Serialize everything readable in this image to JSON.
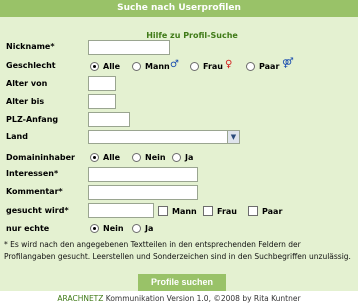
{
  "header": {
    "title": "Suche nach Userprofilen"
  },
  "help_link": "Hilfe zu Profil-Suche",
  "form": {
    "nickname_label": "Nickname*",
    "geschlecht_label": "Geschlecht",
    "geschlecht_options": [
      "Alle",
      "Mann",
      "Frau",
      "Paar"
    ],
    "geschlecht_selected": "Alle",
    "alter_von_label": "Alter von",
    "alter_bis_label": "Alter bis",
    "plz_label": "PLZ-Anfang",
    "land_label": "Land",
    "land_value": "",
    "domaininhaber_label": "Domaininhaber",
    "domaininhaber_options": [
      "Alle",
      "Nein",
      "Ja"
    ],
    "domaininhaber_selected": "Alle",
    "interessen_label": "Interessen*",
    "kommentar_label": "Kommentar*",
    "gesucht_label": "gesucht wird*",
    "gesucht_options": [
      "Mann",
      "Frau",
      "Paar"
    ],
    "nur_echte_label": "nur echte",
    "nur_echte_options": [
      "Nein",
      "Ja"
    ],
    "nur_echte_selected": "Nein"
  },
  "note": "* Es wird nach den angegebenen Textteilen in den entsprechenden Feldern der Profilangaben gesucht. Leerstellen und Sonderzeichen sind in den Suchbegriffen unzulässig.",
  "submit_label": "Profile suchen",
  "footer": {
    "brand": "ARACHNETZ",
    "text": " Kommunikation Version 1.0,   ©2008 by Rita Kuntner"
  },
  "colors": {
    "header_bg": "#99c268",
    "panel_bg": "#e4f1d1",
    "link": "#3f7a17",
    "male_symbol": "#1c4fb0",
    "female_symbol": "#d42020"
  },
  "icons": [
    "male-symbol-icon",
    "female-symbol-icon",
    "couple-symbol-icon",
    "dropdown-arrow-icon"
  ]
}
